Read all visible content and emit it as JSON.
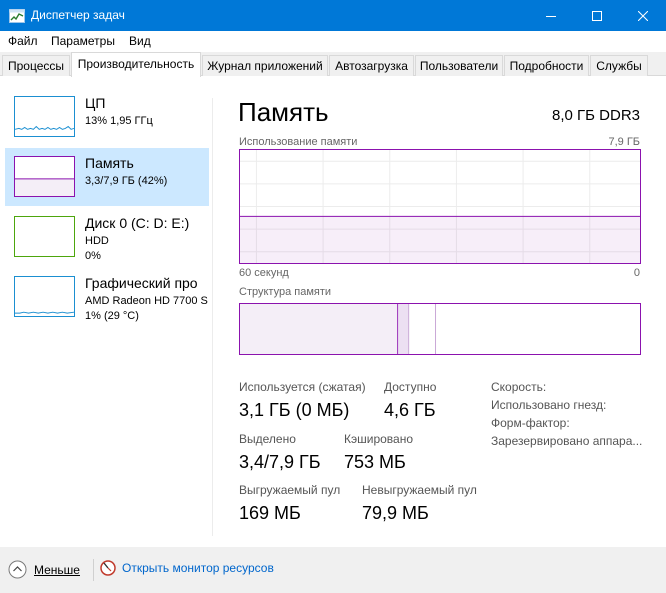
{
  "window": {
    "title": "Диспетчер задач",
    "accent": "#0078d7"
  },
  "menu": [
    "Файл",
    "Параметры",
    "Вид"
  ],
  "tabs": [
    {
      "label": "Процессы",
      "active": false
    },
    {
      "label": "Производительность",
      "active": true
    },
    {
      "label": "Журнал приложений",
      "active": false
    },
    {
      "label": "Автозагрузка",
      "active": false
    },
    {
      "label": "Пользователи",
      "active": false
    },
    {
      "label": "Подробности",
      "active": false
    },
    {
      "label": "Службы",
      "active": false
    }
  ],
  "sidebar": {
    "items": [
      {
        "name": "ЦП",
        "line1": "13%  1,95 ГГц",
        "line2": "",
        "color": "#1b8fd1",
        "selected": false
      },
      {
        "name": "Память",
        "line1": "3,3/7,9 ГБ (42%)",
        "line2": "",
        "color": "#8b12ae",
        "selected": true
      },
      {
        "name": "Диск 0 (C: D: E:)",
        "line1": "HDD",
        "line2": "0%",
        "color": "#4da60c",
        "selected": false
      },
      {
        "name": "Графический про",
        "line1": "AMD Radeon HD 7700 S",
        "line2": "1% (29 °C)",
        "color": "#1b8fd1",
        "selected": false
      }
    ]
  },
  "memory": {
    "title": "Память",
    "spec": "8,0 ГБ DDR3",
    "usage_label": "Использование памяти",
    "usage_max": "7,9 ГБ",
    "time_left": "60 секунд",
    "time_right": "0",
    "structure_label": "Структура памяти",
    "usage_fraction": 0.42,
    "stats": {
      "in_use_label": "Используется (сжатая)",
      "in_use_value": "3,1 ГБ (0 МБ)",
      "available_label": "Доступно",
      "available_value": "4,6 ГБ",
      "committed_label": "Выделено",
      "committed_value": "3,4/7,9 ГБ",
      "cached_label": "Кэшировано",
      "cached_value": "753 МБ",
      "paged_label": "Выгружаемый пул",
      "paged_value": "169 МБ",
      "nonpaged_label": "Невыгружаемый пул",
      "nonpaged_value": "79,9 МБ"
    },
    "info": [
      "Скорость:",
      "Использовано гнезд:",
      "Форм-фактор:",
      "Зарезервировано аппара..."
    ]
  },
  "bottom": {
    "less_label": "Меньше",
    "monitor_label": "Открыть монитор ресурсов"
  }
}
